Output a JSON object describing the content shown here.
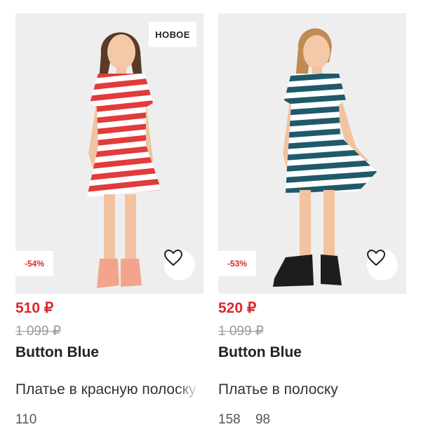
{
  "products": [
    {
      "badge_new": "НОВОЕ",
      "discount": "-54%",
      "price": "510 ₽",
      "old_price": "1 099 ₽",
      "brand": "Button Blue",
      "title": "Платье в красную полоску",
      "sizes": [
        "110"
      ],
      "accent": "#e0262a",
      "dress_colors": [
        "#e23b3b",
        "#ffffff"
      ]
    },
    {
      "discount": "-53%",
      "price": "520 ₽",
      "old_price": "1 099 ₽",
      "brand": "Button Blue",
      "title": "Платье в полоску",
      "sizes": [
        "158",
        "98"
      ],
      "accent": "#e0262a",
      "dress_colors": [
        "#1f5a6b",
        "#ffffff"
      ]
    }
  ],
  "icons": {
    "favorite": "heart-icon"
  }
}
